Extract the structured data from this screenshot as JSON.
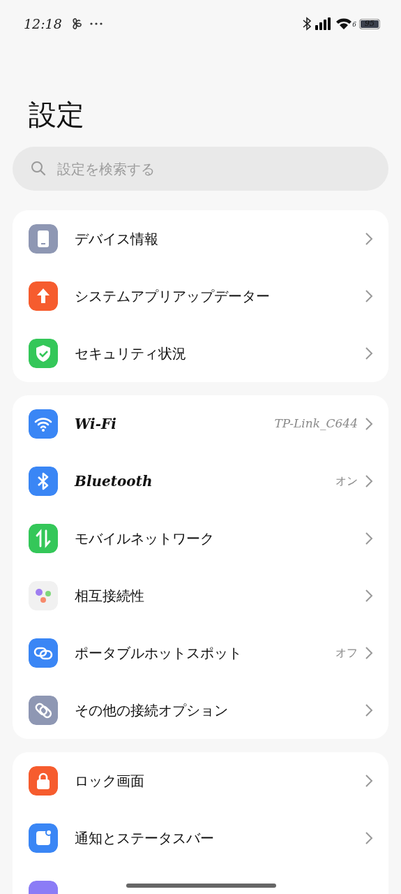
{
  "status_bar": {
    "time": "12:18",
    "wifi_label": "6",
    "battery": "95"
  },
  "title": "設定",
  "search": {
    "placeholder": "設定を検索する"
  },
  "groups": [
    {
      "items": [
        {
          "kind": "device",
          "label": "デバイス情報"
        },
        {
          "kind": "update",
          "label": "システムアプリアップデーター"
        },
        {
          "kind": "shield",
          "label": "セキュリティ状況"
        }
      ]
    },
    {
      "items": [
        {
          "kind": "wifi",
          "label": "Wi-Fi",
          "value": "TP-Link_C644"
        },
        {
          "kind": "bluetooth",
          "label": "Bluetooth",
          "value": "オン"
        },
        {
          "kind": "mobile",
          "label": "モバイルネットワーク"
        },
        {
          "kind": "interconnect",
          "label": "相互接続性"
        },
        {
          "kind": "hotspot",
          "label": "ポータブルホットスポット",
          "value": "オフ"
        },
        {
          "kind": "link",
          "label": "その他の接続オプション"
        }
      ]
    },
    {
      "items": [
        {
          "kind": "lock",
          "label": "ロック画面"
        },
        {
          "kind": "notification",
          "label": "通知とステータスバー"
        },
        {
          "kind": "partial"
        }
      ]
    }
  ]
}
